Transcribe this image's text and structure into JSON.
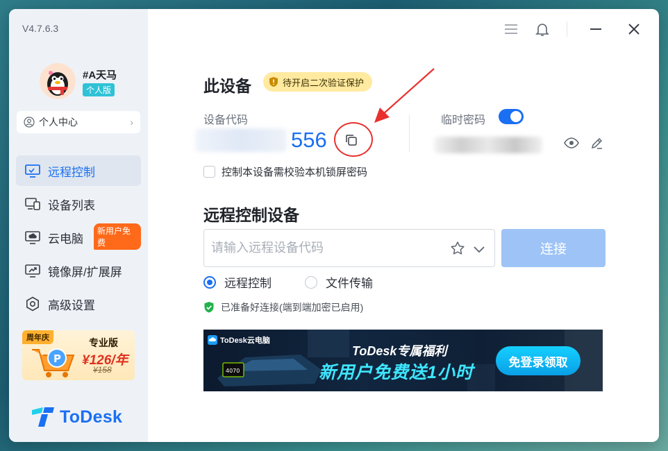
{
  "app": {
    "version": "V4.7.6.3"
  },
  "user": {
    "name": "#A天马",
    "badge": "个人版",
    "center_label": "个人中心"
  },
  "nav": {
    "items": [
      {
        "label": "远程控制",
        "icon": "monitor-remote-icon"
      },
      {
        "label": "设备列表",
        "icon": "devices-icon"
      },
      {
        "label": "云电脑",
        "icon": "cloud-pc-icon",
        "badge": "新用户免费"
      },
      {
        "label": "镜像屏/扩展屏",
        "icon": "mirror-screen-icon"
      },
      {
        "label": "高级设置",
        "icon": "settings-hex-icon"
      }
    ],
    "active_index": 0
  },
  "promo": {
    "anniversary": "周年庆",
    "title": "专业版",
    "price": "¥126/年",
    "original": "¥158"
  },
  "logo": {
    "text": "ToDesk"
  },
  "device": {
    "title": "此设备",
    "verify_badge": "待开启二次验证保护",
    "code_label": "设备代码",
    "code_visible": "556",
    "temp_pwd_label": "临时密码",
    "temp_pwd_enabled": true,
    "lock_check_label": "控制本设备需校验本机锁屏密码"
  },
  "remote": {
    "title": "远程控制设备",
    "input_placeholder": "请输入远程设备代码",
    "connect_label": "连接",
    "modes": [
      {
        "label": "远程控制",
        "selected": true
      },
      {
        "label": "文件传输",
        "selected": false
      }
    ],
    "status": "已准备好连接(端到端加密已启用)"
  },
  "banner": {
    "brand": "ToDesk云电脑",
    "subtitle": "ToDesk专属福利",
    "headline": "新用户免费送1小时",
    "cta": "免登录领取"
  },
  "colors": {
    "accent": "#1b6ff2",
    "annotation": "#e8312f"
  }
}
